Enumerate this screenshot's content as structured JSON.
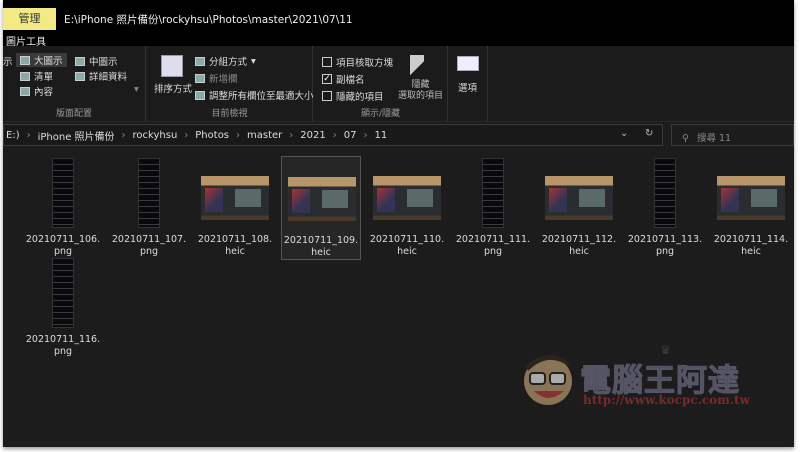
{
  "titlebar": {
    "context_tab": "管理",
    "path": "E:\\iPhone 照片備份\\rockyhsu\\Photos\\master\\2021\\07\\11",
    "context_label": "圖片工具"
  },
  "ribbon": {
    "layout": {
      "title": "版面配置",
      "items": [
        "示",
        "大圖示",
        "中圖示",
        "清單",
        "詳細資料",
        "內容"
      ]
    },
    "current_view": {
      "title": "目前檢視",
      "sort": "排序方式",
      "group": "分組方式",
      "add_column": "新增欄",
      "fit_columns": "調整所有欄位至最適大小"
    },
    "show_hide": {
      "title": "顯示/隱藏",
      "checkboxes": [
        {
          "label": "項目核取方塊",
          "checked": false
        },
        {
          "label": "副檔名",
          "checked": true
        },
        {
          "label": "隱藏的項目",
          "checked": false
        }
      ],
      "hide_selected": [
        "隱藏",
        "選取的項目"
      ]
    },
    "options": "選項"
  },
  "address": {
    "crumbs": [
      "E:)",
      "iPhone 照片備份",
      "rockyhsu",
      "Photos",
      "master",
      "2021",
      "07",
      "11"
    ]
  },
  "search": {
    "placeholder": "搜尋 11"
  },
  "files": [
    {
      "name": "20210711_106.png",
      "type": "portrait"
    },
    {
      "name": "20210711_107.png",
      "type": "portrait"
    },
    {
      "name": "20210711_108.heic",
      "type": "landscape"
    },
    {
      "name": "20210711_109.heic",
      "type": "landscape",
      "selected": true
    },
    {
      "name": "20210711_110.heic",
      "type": "landscape"
    },
    {
      "name": "20210711_111.png",
      "type": "portrait"
    },
    {
      "name": "20210711_112.heic",
      "type": "landscape"
    },
    {
      "name": "20210711_113.png",
      "type": "portrait"
    },
    {
      "name": "20210711_114.heic",
      "type": "landscape"
    },
    {
      "name": "20210711_116.png",
      "type": "portrait"
    }
  ],
  "watermark": {
    "title": "電腦王阿達",
    "url": "http://www.kocpc.com.tw"
  }
}
